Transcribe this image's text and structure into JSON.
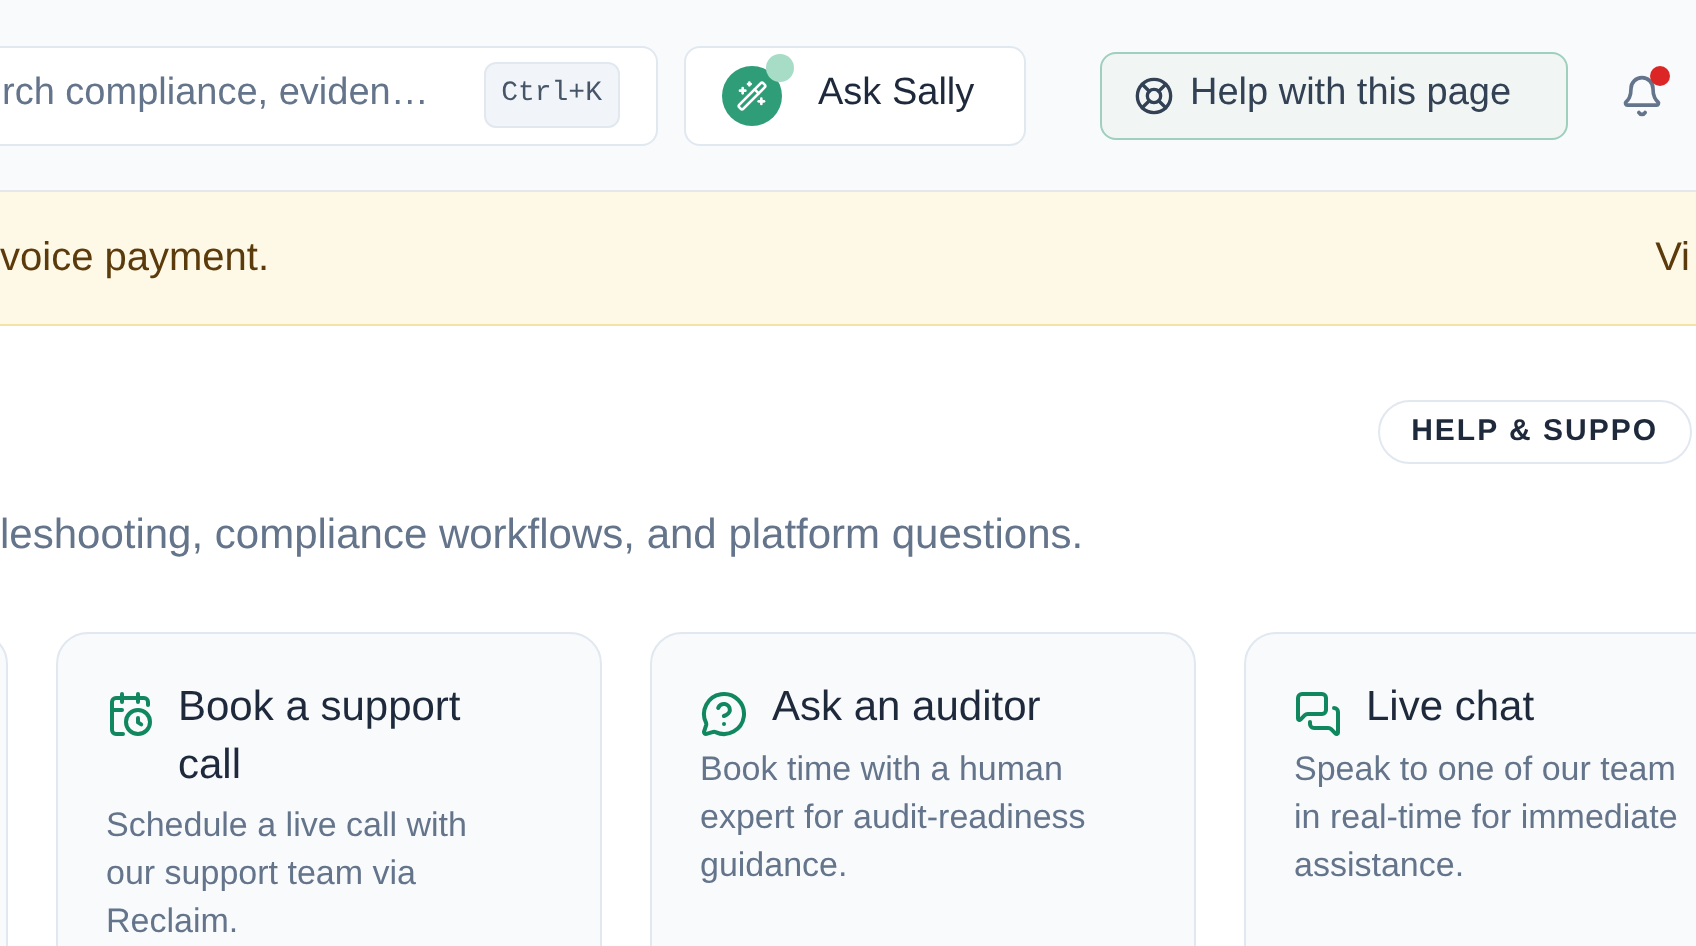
{
  "header": {
    "search": {
      "placeholder": "rch compliance, eviden…",
      "shortcut": "Ctrl+K"
    },
    "assistant_button": "Ask Sally",
    "help_button": "Help with this page",
    "notifications": {
      "unread": true
    }
  },
  "banner": {
    "message": "voice payment.",
    "action": "Vi"
  },
  "badge": "HELP & SUPPO",
  "subtitle": "leshooting, compliance workflows, and platform questions.",
  "cards": [
    {
      "kind": "calendar",
      "title": "Book a support call",
      "description": "Schedule a live call with our support team via Reclaim."
    },
    {
      "kind": "question",
      "title": "Ask an auditor",
      "description": "Book time with a human expert for audit-readiness guidance."
    },
    {
      "kind": "chat",
      "title": "Live chat",
      "description": "Speak to one of our team in real-time for immediate assistance."
    }
  ]
}
